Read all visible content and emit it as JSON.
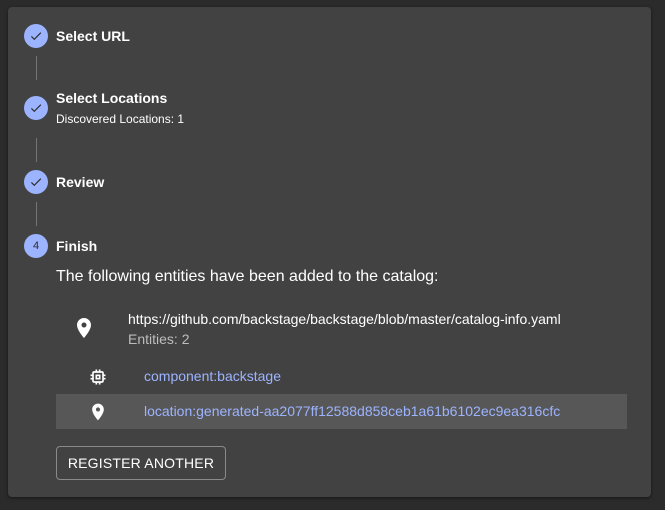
{
  "steps": [
    {
      "label": "Select URL",
      "state": "completed",
      "icon": "check-icon"
    },
    {
      "label": "Select Locations",
      "sublabel": "Discovered Locations: 1",
      "state": "completed",
      "icon": "check-icon"
    },
    {
      "label": "Review",
      "state": "completed",
      "icon": "check-icon"
    },
    {
      "label": "Finish",
      "number": "4",
      "state": "active"
    }
  ],
  "finish": {
    "intro": "The following entities have been added to the catalog:",
    "location": {
      "url": "https://github.com/backstage/backstage/blob/master/catalog-info.yaml",
      "entities_count_text": "Entities: 2",
      "icon": "location-pin-icon"
    },
    "entities": [
      {
        "ref": "component:backstage",
        "icon": "component-chip-icon",
        "selected": false
      },
      {
        "ref": "location:generated-aa2077ff12588d858ceb1a61b6102ec9ea316cfc",
        "icon": "location-pin-icon",
        "selected": true
      }
    ],
    "register_another_label": "REGISTER ANOTHER"
  },
  "colors": {
    "background": "#2b2b2b",
    "card": "#424242",
    "accent": "#9cb4ff",
    "selected_row": "#575757",
    "text": "#ffffff",
    "secondary_text": "#bdbdbd",
    "connector": "#757575"
  }
}
